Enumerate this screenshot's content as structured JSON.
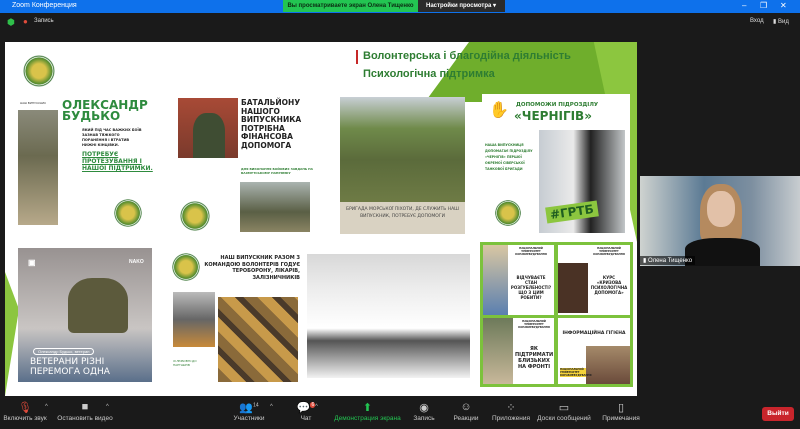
{
  "window": {
    "title": "Zoom Конференция",
    "banner": "Вы просматриваете экран Олена Тищенко",
    "view_options": "Настройки просмотра",
    "minimize": "–",
    "maximize": "❐",
    "close": "✕"
  },
  "topbar": {
    "record": "Запись",
    "signin": "Вход",
    "view": "Вид"
  },
  "slide": {
    "title_line1": "Волонтерська і благодійна діяльність",
    "title_line2": "Психологічна підтримка",
    "budko": {
      "small": "НАШ ВИПУСКНИК",
      "name1": "ОЛЕКСАНДР",
      "name2": "БУДЬКО",
      "desc": "ЯКИЙ ПІД ЧАС ВАЖКИХ БОЇВ ЗАЗНАВ ТЯЖКОГО ПОРАНЕННЯ І ВТРАТИВ НИЖНІ КІНЦІВКИ.",
      "need": "ПОТРЕБУЄ ПРОТЕЗУВАННЯ І НАШОЇ ПІДТРИМКИ."
    },
    "battalion": {
      "heading": "БАТАЛЬЙОНУ НАШОГО ВИПУСКНИКА ПОТРІБНА ФІНАНСОВА ДОПОМОГА",
      "sub": "ДЛЯ ВИКОНАННЯ БОЙОВИХ ЗАВДАНЬ НА БАХМУТСЬКОМУ НАПРЯМКУ"
    },
    "brigade": {
      "caption": "БРИГАДА МОРСЬКОЇ ПІХОТИ, ДЕ СЛУЖИТЬ НАШ ВИПУСКНИК, ПОТРЕБУЄ ДОПОМОГИ"
    },
    "chernihiv": {
      "heading1": "ДОПОМОЖИ ПІДРОЗДІЛУ",
      "heading2": "«ЧЕРНІГІВ»",
      "desc": "НАША ВИПУСКНИЦЯ ДОПОМАГАЄ ПІДРОЗДІЛУ «ЧЕРНІГІВ» ПЕРШОЇ ОКРЕМОЇ СІВЕРСЬКОЇ ТАНКОВОЇ БРИГАДИ",
      "hashtag": "#ГРТБ"
    },
    "veterans": {
      "logo": "NAKO",
      "tag": "Олександр Будько, ветеран",
      "title1": "ВЕТЕРАНИ РІЗНІ",
      "title2": "ПЕРЕМОГА ОДНА"
    },
    "feeding": {
      "heading": "НАШ ВИПУСКНИК РАЗОМ З КОМАНДОЮ ВОЛОНТЕРІВ ГОДУЄ ТЕРОБОРОНУ, ЛІКАРІВ, ЗАЛІЗНИЧНИКІВ",
      "foot": "ЗІ ЛЮБОВ'Ю ДО ПАРТНЕРІВ"
    },
    "psych": {
      "tiles": [
        {
          "org": "НАЦІОНАЛЬНИЙ УНІВЕРСИТЕТ КОРАБЛЕБУДУВАННЯ",
          "text": "ВІДЧУВАЄТЕ СТАН РОЗГУБЛЕНОСТІ? ЩО З ЦИМ РОБИТИ?"
        },
        {
          "org": "НАЦІОНАЛЬНИЙ УНІВЕРСИТЕТ КОРАБЛЕБУДУВАННЯ",
          "text": "КУРС «КРИЗОВА ПСИХОЛОГІЧНА ДОПОМОГА»"
        },
        {
          "org": "НАЦІОНАЛЬНИЙ УНІВЕРСИТЕТ КОРАБЛЕБУДУВАННЯ",
          "text": "ЯК ПІДТРИМАТИ БЛИЗЬКИХ НА ФРОНТІ"
        },
        {
          "org": "НАЦІОНАЛЬНИЙ УНІВЕРСИТЕТ КОРАБЛЕБУДУВАННЯ",
          "text": "ІНФОРМАЦІЙНА ГІГІЄНА"
        }
      ]
    }
  },
  "participant": {
    "name": "Олена Тищенко"
  },
  "toolbar": {
    "unmute": "Включить звук",
    "stop_video": "Остановить видео",
    "participants": "Участники",
    "participants_count": "14",
    "chat": "Чат",
    "chat_badge": "6",
    "share": "Демонстрация экрана",
    "record": "Запись",
    "reactions": "Реакции",
    "apps": "Приложения",
    "whiteboards": "Доски сообщений",
    "notes": "Примечания",
    "leave": "Выйти"
  },
  "colors": {
    "zoom_blue": "#0e71eb",
    "share_green": "#23c552",
    "slide_green": "#8cc63f",
    "title_green": "#2e7d32",
    "leave_red": "#c9252c"
  }
}
